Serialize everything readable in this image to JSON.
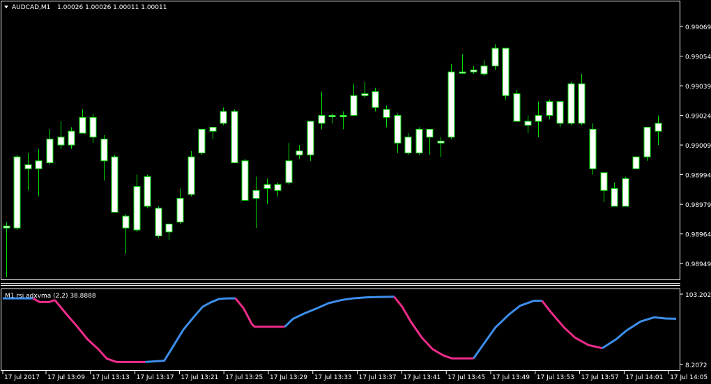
{
  "colors": {
    "background": "#000000",
    "frame": "#ffffff",
    "bull_candle": "#00e000",
    "bull_body": "#ffffff",
    "bear_candle": "#00e000",
    "bear_body": "#ffffff",
    "rsi_up": "#3d8eea",
    "rsi_down": "#ee2c8b"
  },
  "header": {
    "symbol": "AUDCAD,M1",
    "ohlc": "1.00026 1.00026 1.00011 1.00011",
    "icon": "triangle-down-icon"
  },
  "indicator": {
    "label": "M1 rsi adxvma (2,2) 38.8888",
    "y_top_label": "103.202",
    "y_bottom_label": "8.2072"
  },
  "price_axis_labels": [
    "0.99069",
    "0.99054",
    "0.99039",
    "0.99024",
    "0.99009",
    "0.98994",
    "0.98979",
    "0.98964",
    "0.98949"
  ],
  "time_axis_labels": [
    "17 Jul 2017",
    "17 Jul 13:09",
    "17 Jul 13:13",
    "17 Jul 13:17",
    "17 Jul 13:21",
    "17 Jul 13:25",
    "17 Jul 13:29",
    "17 Jul 13:33",
    "17 Jul 13:37",
    "17 Jul 13:41",
    "17 Jul 13:45",
    "17 Jul 13:49",
    "17 Jul 13:53",
    "17 Jul 13:57",
    "17 Jul 14:01",
    "17 Jul 14:05"
  ],
  "chart_data": [
    {
      "type": "candlestick",
      "title": "AUDCAD,M1",
      "ylim": [
        0.98942,
        0.99081
      ],
      "categories": [
        "17 Jul 13:05",
        "13:06",
        "13:07",
        "13:08",
        "13:09",
        "13:10",
        "13:11",
        "13:12",
        "13:13",
        "13:14",
        "13:15",
        "13:16",
        "13:17",
        "13:18",
        "13:19",
        "13:20",
        "13:21",
        "13:22",
        "13:23",
        "13:24",
        "13:25",
        "13:26",
        "13:27",
        "13:28",
        "13:29",
        "13:30",
        "13:31",
        "13:32",
        "13:33",
        "13:34",
        "13:35",
        "13:36",
        "13:37",
        "13:38",
        "13:39",
        "13:40",
        "13:41",
        "13:42",
        "13:43",
        "13:44",
        "13:45",
        "13:46",
        "13:47",
        "13:48",
        "13:49",
        "13:50",
        "13:51",
        "13:52",
        "13:53",
        "13:54",
        "13:55",
        "13:56",
        "13:57",
        "13:58",
        "13:59",
        "14:00",
        "14:01",
        "14:02",
        "14:03",
        "14:04",
        "14:05"
      ],
      "candles": [
        {
          "o": 0.98967,
          "h": 0.9897,
          "l": 0.98942,
          "c": 0.98968
        },
        {
          "o": 0.98967,
          "h": 0.99004,
          "l": 0.98966,
          "c": 0.99003
        },
        {
          "o": 0.98997,
          "h": 0.99005,
          "l": 0.98986,
          "c": 0.98999
        },
        {
          "o": 0.98997,
          "h": 0.99007,
          "l": 0.98983,
          "c": 0.99001
        },
        {
          "o": 0.99,
          "h": 0.99017,
          "l": 0.98999,
          "c": 0.99012
        },
        {
          "o": 0.99009,
          "h": 0.99021,
          "l": 0.99007,
          "c": 0.99013
        },
        {
          "o": 0.99009,
          "h": 0.99018,
          "l": 0.99007,
          "c": 0.99016
        },
        {
          "o": 0.99015,
          "h": 0.99027,
          "l": 0.99015,
          "c": 0.99023
        },
        {
          "o": 0.99023,
          "h": 0.99025,
          "l": 0.9901,
          "c": 0.99013
        },
        {
          "o": 0.99012,
          "h": 0.99014,
          "l": 0.98991,
          "c": 0.99001
        },
        {
          "o": 0.99003,
          "h": 0.99004,
          "l": 0.98982,
          "c": 0.98975
        },
        {
          "o": 0.98973,
          "h": 0.98974,
          "l": 0.98954,
          "c": 0.98967
        },
        {
          "o": 0.98988,
          "h": 0.98994,
          "l": 0.98965,
          "c": 0.98966
        },
        {
          "o": 0.98993,
          "h": 0.98994,
          "l": 0.98977,
          "c": 0.98978
        },
        {
          "o": 0.98977,
          "h": 0.98978,
          "l": 0.98962,
          "c": 0.98963
        },
        {
          "o": 0.98965,
          "h": 0.98967,
          "l": 0.98961,
          "c": 0.98969
        },
        {
          "o": 0.9897,
          "h": 0.98987,
          "l": 0.98969,
          "c": 0.98982
        },
        {
          "o": 0.98984,
          "h": 0.99006,
          "l": 0.98983,
          "c": 0.99003
        },
        {
          "o": 0.99005,
          "h": 0.99016,
          "l": 0.99004,
          "c": 0.99017
        },
        {
          "o": 0.99016,
          "h": 0.99017,
          "l": 0.99012,
          "c": 0.99018
        },
        {
          "o": 0.9902,
          "h": 0.99028,
          "l": 0.99019,
          "c": 0.99026
        },
        {
          "o": 0.99026,
          "h": 0.99027,
          "l": 0.99001,
          "c": 0.99
        },
        {
          "o": 0.99001,
          "h": 0.99002,
          "l": 0.98981,
          "c": 0.98981
        },
        {
          "o": 0.98986,
          "h": 0.98993,
          "l": 0.98967,
          "c": 0.98982
        },
        {
          "o": 0.98987,
          "h": 0.98992,
          "l": 0.98979,
          "c": 0.98989
        },
        {
          "o": 0.98986,
          "h": 0.9899,
          "l": 0.98983,
          "c": 0.98989
        },
        {
          "o": 0.9899,
          "h": 0.9901,
          "l": 0.98989,
          "c": 0.99001
        },
        {
          "o": 0.99004,
          "h": 0.99009,
          "l": 0.99002,
          "c": 0.99006
        },
        {
          "o": 0.99004,
          "h": 0.99021,
          "l": 0.99001,
          "c": 0.99021
        },
        {
          "o": 0.9902,
          "h": 0.99036,
          "l": 0.99017,
          "c": 0.99024
        },
        {
          "o": 0.99024,
          "h": 0.99025,
          "l": 0.9902,
          "c": 0.99024
        },
        {
          "o": 0.99024,
          "h": 0.99026,
          "l": 0.99017,
          "c": 0.99024
        },
        {
          "o": 0.99024,
          "h": 0.9904,
          "l": 0.99024,
          "c": 0.99034
        },
        {
          "o": 0.99034,
          "h": 0.99041,
          "l": 0.99033,
          "c": 0.99035
        },
        {
          "o": 0.99036,
          "h": 0.99038,
          "l": 0.99026,
          "c": 0.99028
        },
        {
          "o": 0.99027,
          "h": 0.99029,
          "l": 0.99018,
          "c": 0.99023
        },
        {
          "o": 0.99024,
          "h": 0.99025,
          "l": 0.99005,
          "c": 0.9901
        },
        {
          "o": 0.99013,
          "h": 0.99015,
          "l": 0.99004,
          "c": 0.99005
        },
        {
          "o": 0.99005,
          "h": 0.99018,
          "l": 0.99004,
          "c": 0.99017
        },
        {
          "o": 0.99017,
          "h": 0.99017,
          "l": 0.99004,
          "c": 0.99013
        },
        {
          "o": 0.9901,
          "h": 0.99013,
          "l": 0.99003,
          "c": 0.99011
        },
        {
          "o": 0.99013,
          "h": 0.9905,
          "l": 0.99012,
          "c": 0.99046
        },
        {
          "o": 0.99046,
          "h": 0.99055,
          "l": 0.99045,
          "c": 0.99046
        },
        {
          "o": 0.99046,
          "h": 0.99049,
          "l": 0.99045,
          "c": 0.99047
        },
        {
          "o": 0.99045,
          "h": 0.99052,
          "l": 0.99044,
          "c": 0.99049
        },
        {
          "o": 0.99049,
          "h": 0.9906,
          "l": 0.99047,
          "c": 0.99058
        },
        {
          "o": 0.99058,
          "h": 0.99058,
          "l": 0.99032,
          "c": 0.99034
        },
        {
          "o": 0.99035,
          "h": 0.99037,
          "l": 0.99022,
          "c": 0.99021
        },
        {
          "o": 0.99021,
          "h": 0.99024,
          "l": 0.99015,
          "c": 0.99019
        },
        {
          "o": 0.99021,
          "h": 0.99031,
          "l": 0.99013,
          "c": 0.99024
        },
        {
          "o": 0.99024,
          "h": 0.99032,
          "l": 0.99022,
          "c": 0.99031
        },
        {
          "o": 0.99031,
          "h": 0.99031,
          "l": 0.99018,
          "c": 0.9902
        },
        {
          "o": 0.9902,
          "h": 0.99041,
          "l": 0.99019,
          "c": 0.9904
        },
        {
          "o": 0.9904,
          "h": 0.99045,
          "l": 0.99019,
          "c": 0.9902
        },
        {
          "o": 0.99017,
          "h": 0.9902,
          "l": 0.98994,
          "c": 0.98997
        },
        {
          "o": 0.98995,
          "h": 0.98995,
          "l": 0.9898,
          "c": 0.98986
        },
        {
          "o": 0.98987,
          "h": 0.9899,
          "l": 0.98978,
          "c": 0.98978
        },
        {
          "o": 0.98978,
          "h": 0.98993,
          "l": 0.98978,
          "c": 0.98992
        },
        {
          "o": 0.98997,
          "h": 0.99,
          "l": 0.98997,
          "c": 0.99003
        },
        {
          "o": 0.99003,
          "h": 0.99018,
          "l": 0.99001,
          "c": 0.99018
        },
        {
          "o": 0.99016,
          "h": 0.99024,
          "l": 0.99009,
          "c": 0.9902
        }
      ]
    },
    {
      "type": "line",
      "title": "M1 rsi adxvma (2,2) 38.8888",
      "ylim": [
        8.2072,
        103.202
      ],
      "segments": [
        {
          "color": "up",
          "points": [
            [
              0,
              97.5
            ],
            [
              11,
              97.5
            ]
          ]
        },
        {
          "color": "down",
          "points": [
            [
              11,
              97.5
            ],
            [
              13.5,
              92.5
            ],
            [
              17,
              92.5
            ],
            [
              19,
              95.3
            ]
          ]
        },
        {
          "color": "down",
          "points": [
            [
              19,
              95.3
            ],
            [
              23,
              77.3
            ],
            [
              27,
              60.2
            ],
            [
              31,
              42.1
            ],
            [
              35,
              28.5
            ],
            [
              38,
              16.1
            ],
            [
              41.5,
              11.6
            ],
            [
              46,
              11.6
            ],
            [
              50,
              11.6
            ],
            [
              52,
              11.6
            ]
          ]
        },
        {
          "color": "up",
          "points": [
            [
              52,
              11.6
            ],
            [
              56,
              12.5
            ],
            [
              59,
              13.4
            ],
            [
              62,
              31.3
            ],
            [
              66,
              55.4
            ],
            [
              70,
              73.3
            ],
            [
              73,
              86.1
            ],
            [
              76,
              92.1
            ],
            [
              79,
              96.6
            ],
            [
              82,
              97.5
            ],
            [
              85,
              97.5
            ]
          ]
        },
        {
          "color": "down",
          "points": [
            [
              85,
              97.5
            ],
            [
              88,
              83.8
            ],
            [
              91,
              62.7
            ],
            [
              92,
              59.1
            ],
            [
              96,
              59.1
            ],
            [
              100,
              59.1
            ],
            [
              103,
              59.1
            ]
          ]
        },
        {
          "color": "up",
          "points": [
            [
              103,
              59.1
            ],
            [
              106,
              69.7
            ],
            [
              110,
              76.9
            ],
            [
              115,
              84.4
            ],
            [
              119,
              91.0
            ],
            [
              124,
              95.4
            ],
            [
              128,
              97.5
            ],
            [
              133,
              98.9
            ],
            [
              138,
              99.3
            ],
            [
              143,
              99.6
            ]
          ]
        },
        {
          "color": "down",
          "points": [
            [
              143,
              99.6
            ],
            [
              146,
              85.6
            ],
            [
              149,
              66.4
            ],
            [
              153,
              44.9
            ],
            [
              157,
              29.0
            ],
            [
              161,
              20.3
            ],
            [
              164,
              16.5
            ],
            [
              168,
              16.5
            ],
            [
              172,
              16.5
            ]
          ]
        },
        {
          "color": "up",
          "points": [
            [
              172,
              16.5
            ],
            [
              176,
              37.5
            ],
            [
              180,
              58.2
            ],
            [
              185,
              75.9
            ],
            [
              189,
              87.5
            ],
            [
              194,
              94.2
            ],
            [
              197,
              94.2
            ]
          ]
        },
        {
          "color": "down",
          "points": [
            [
              197,
              94.2
            ],
            [
              200,
              79.9
            ],
            [
              205,
              58.3
            ],
            [
              209,
              44.6
            ],
            [
              214,
              34.4
            ],
            [
              219,
              30.2
            ]
          ]
        },
        {
          "color": "up",
          "points": [
            [
              219,
              30.2
            ],
            [
              224,
              42.1
            ],
            [
              228,
              54.4
            ],
            [
              233,
              66.2
            ],
            [
              238,
              71.9
            ],
            [
              242,
              70.3
            ],
            [
              246,
              69.9
            ]
          ]
        }
      ]
    }
  ]
}
